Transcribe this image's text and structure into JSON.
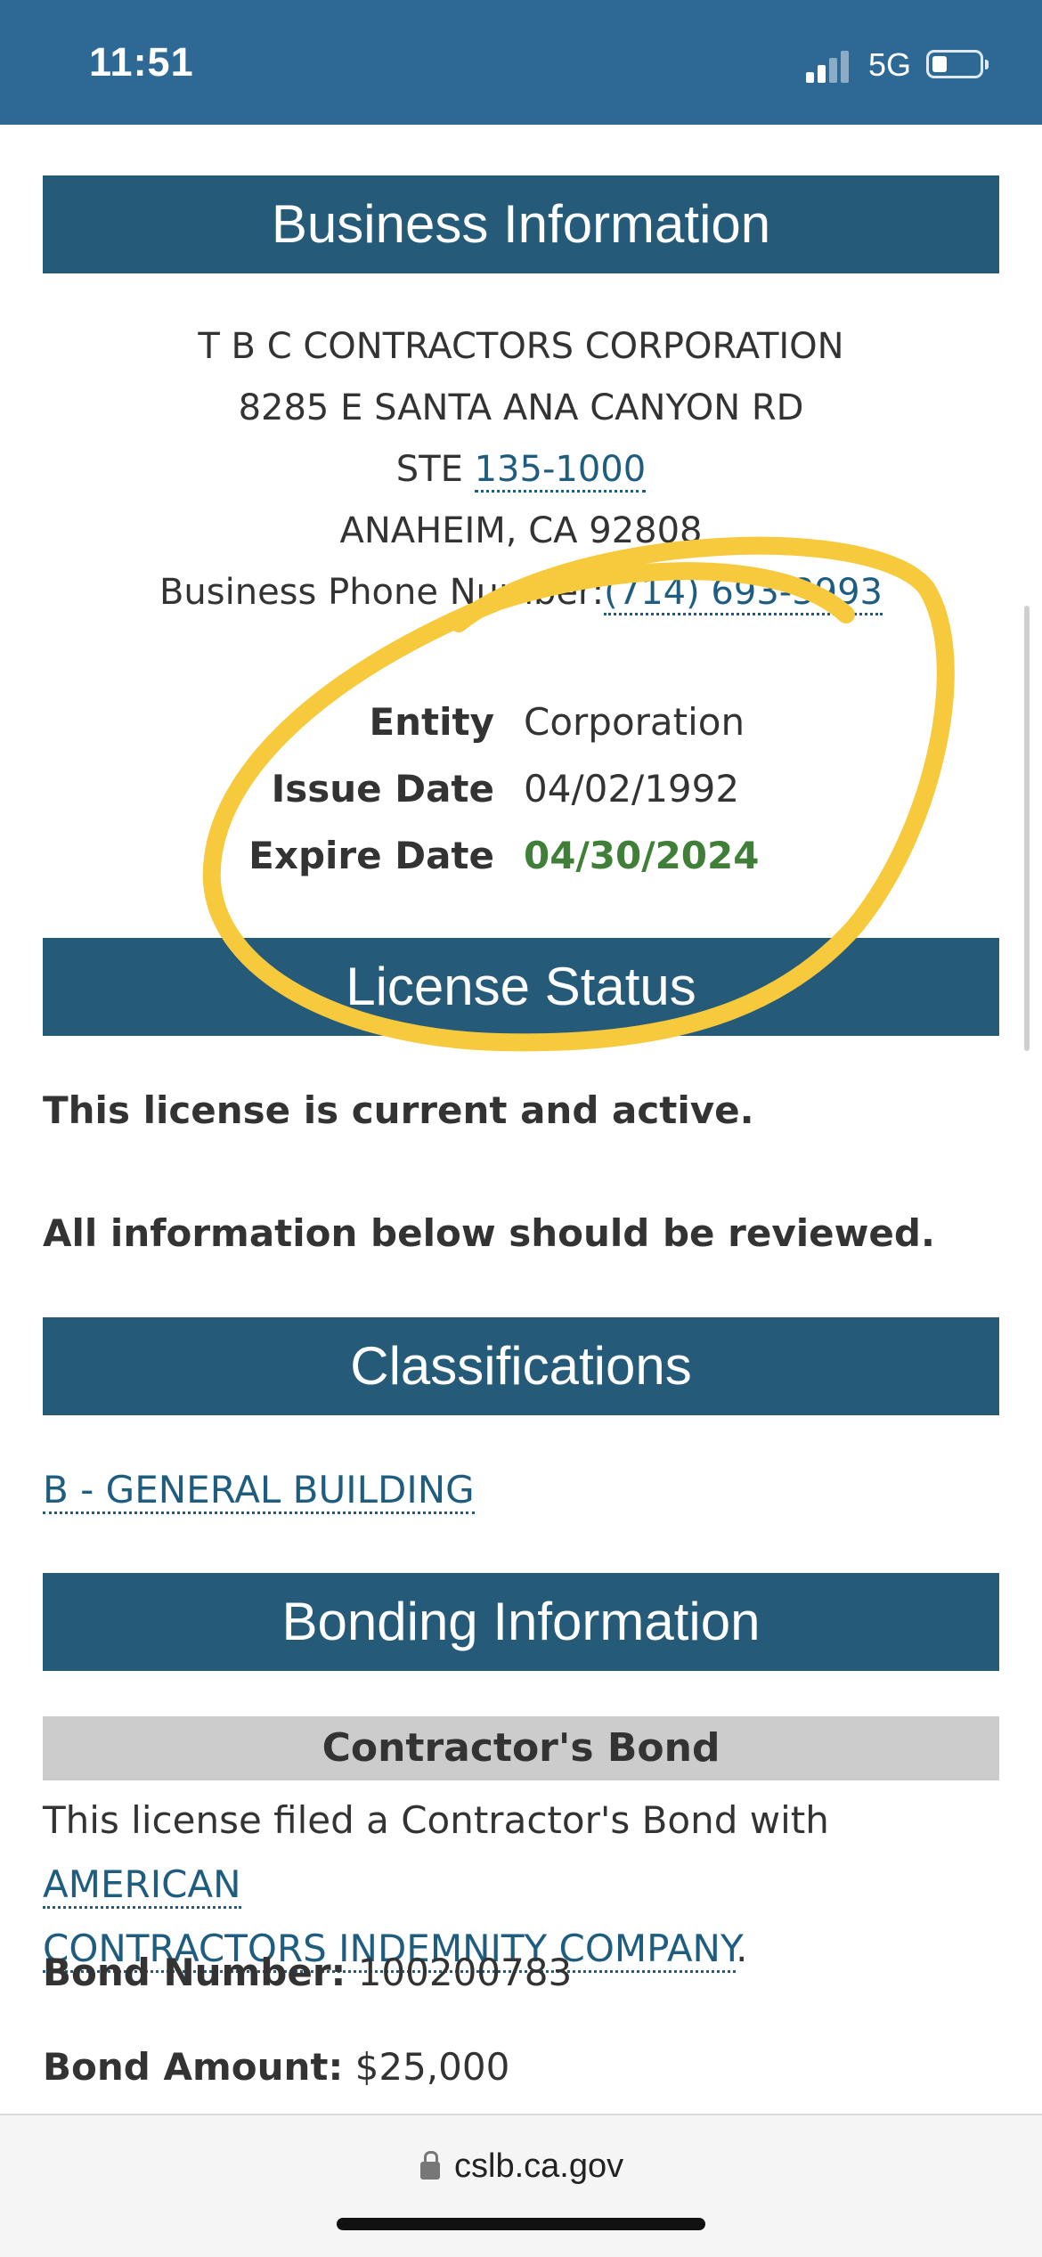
{
  "status_bar": {
    "time": "11:51",
    "network": "5G"
  },
  "business": {
    "header": "Business Information",
    "name": "T B C CONTRACTORS CORPORATION",
    "address1": "8285 E SANTA ANA CANYON RD",
    "suite_prefix": "STE ",
    "suite_link": "135-1000",
    "city": "ANAHEIM, CA 92808",
    "phone_label": "Business Phone Number:",
    "phone": "(714) 693-3993",
    "entity_label": "Entity",
    "entity_value": "Corporation",
    "issue_label": "Issue Date",
    "issue_value": "04/02/1992",
    "expire_label": "Expire Date",
    "expire_value": "04/30/2024"
  },
  "license_status": {
    "header": "License Status",
    "status_text": "This license is current and active.",
    "review_text": "All information below should be reviewed."
  },
  "classifications": {
    "header": "Classifications",
    "item": "B - GENERAL BUILDING"
  },
  "bonding": {
    "header": "Bonding Information",
    "sub_header": "Contractor's Bond",
    "text_prefix": "This license filed a Contractor's Bond with ",
    "company_line1": "AMERICAN",
    "company_line2": "CONTRACTORS INDEMNITY COMPANY",
    "period": ".",
    "bond_number_label": "Bond Number:",
    "bond_number": "100200783",
    "bond_amount_label": "Bond Amount:",
    "bond_amount": "$25,000"
  },
  "browser": {
    "url": "cslb.ca.gov"
  },
  "colors": {
    "header_bg": "#255a79",
    "status_bar_bg": "#2e6996",
    "green": "#3f7f38",
    "annotation": "#f7c93c"
  }
}
